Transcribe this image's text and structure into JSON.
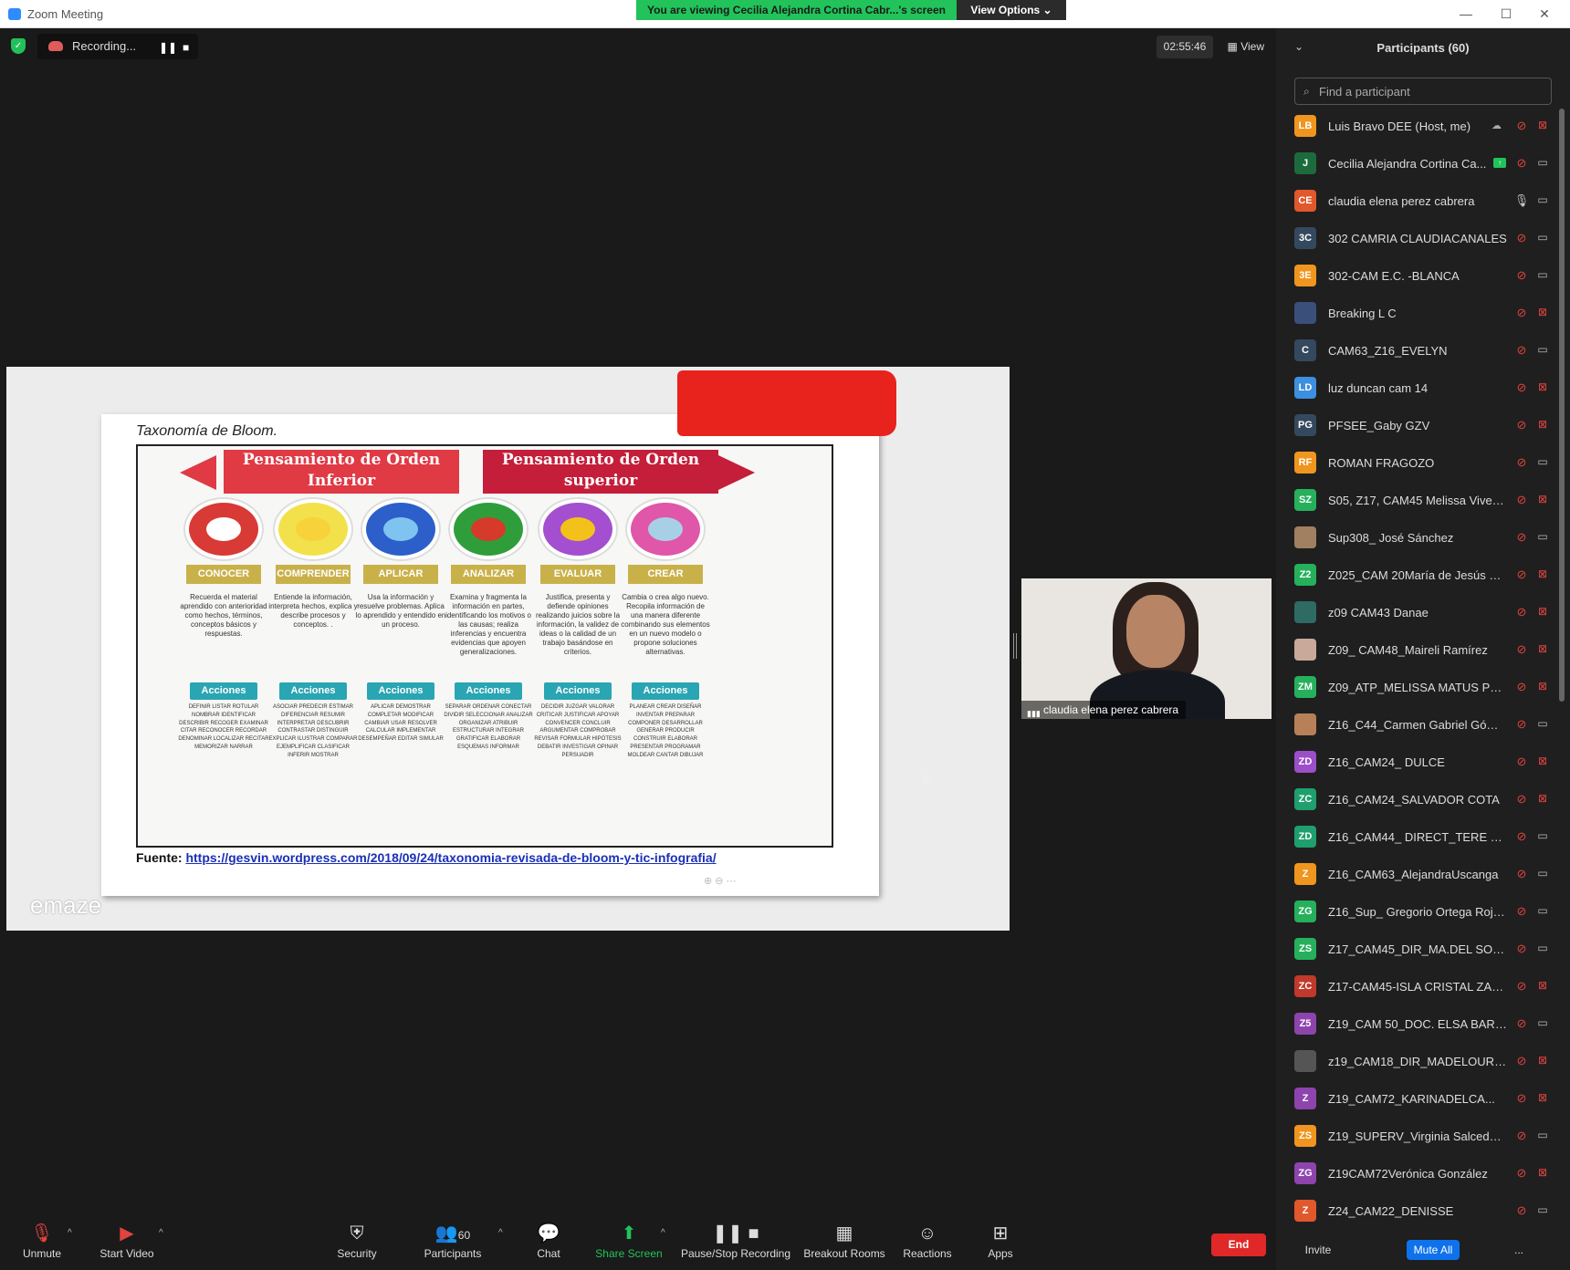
{
  "window": {
    "title": "Zoom Meeting",
    "controls": {
      "minimize": "—",
      "maximize": "☐",
      "close": "✕"
    }
  },
  "banner": {
    "viewing_text": "You are viewing Cecilia Alejandra Cortina Cabr...'s screen",
    "view_options": "View Options ⌄"
  },
  "recording": {
    "label": "Recording...",
    "pause": "❚❚",
    "stop": "■"
  },
  "meeting": {
    "timer": "02:55:46",
    "view_label": "View"
  },
  "shared_doc": {
    "title": "Taxonomía de Bloom.",
    "header_left": "Pensamiento de Orden Inferior",
    "header_right": "Pensamiento de Orden superior",
    "levels": [
      {
        "name": "CONOCER",
        "color": "#d83a35",
        "desc": "Recuerda el material aprendido con anterioridad como hechos, términos, conceptos básicos y respuestas.",
        "actions_label": "Acciones",
        "verbs": "DEFINIR LISTAR ROTULAR NOMBRAR IDENTIFICAR DESCRIBIR RECOGER EXAMINAR CITAR RECONOCER RECORDAR DENOMINAR LOCALIZAR RECITAR MEMORIZAR NARRAR"
      },
      {
        "name": "COMPRENDER",
        "color": "#f2e14a",
        "desc": "Entiende la información, interpreta hechos, explica y describe procesos y conceptos. .",
        "actions_label": "Acciones",
        "verbs": "ASOCIAR PREDECIR ESTIMAR DIFERENCIAR RESUMIR INTERPRETAR DESCUBRIR CONTRASTAR DISTINGUIR EXPLICAR ILUSTRAR COMPARAR EJEMPLIFICAR CLASIFICAR INFERIR MOSTRAR"
      },
      {
        "name": "APLICAR",
        "color": "#2c5fc9",
        "desc": "Usa la información y resuelve problemas. Aplica lo aprendido y entendido en un proceso.",
        "actions_label": "Acciones",
        "verbs": "APLICAR DEMOSTRAR COMPLETAR MODIFICAR CAMBIAR USAR RESOLVER CALCULAR IMPLEMENTAR DESEMPEÑAR EDITAR SIMULAR"
      },
      {
        "name": "ANALIZAR",
        "color": "#2f9e3a",
        "desc": "Examina y fragmenta la información en partes, identificando los motivos o las causas; realiza inferencias y encuentra evidencias que apoyen generalizaciones.",
        "actions_label": "Acciones",
        "verbs": "SEPARAR ORDENAR CONECTAR DIVIDIR SELECCIONAR ANALIZAR ORGANIZAR ATRIBUIR ESTRUCTURAR INTEGRAR GRATIFICAR ELABORAR ESQUEMAS INFORMAR"
      },
      {
        "name": "EVALUAR",
        "color": "#a34fd0",
        "desc": "Justifica, presenta y defiende opiniones realizando juicios sobre la información, la validez de ideas o la calidad de un trabajo basándose en criterios.",
        "actions_label": "Acciones",
        "verbs": "DECIDIR JUZGAR VALORAR CRITICAR JUSTIFICAR APOYAR CONVENCER CONCLUIR ARGUMENTAR COMPROBAR REVISAR FORMULAR HIPÓTESIS DEBATIR INVESTIGAR OPINAR PERSUADIR"
      },
      {
        "name": "CREAR",
        "color": "#e056a8",
        "desc": "Cambia o crea algo nuevo. Recopila información de una manera diferente combinando sus elementos en un nuevo modelo o propone soluciones alternativas.",
        "actions_label": "Acciones",
        "verbs": "PLANEAR CREAR DISEÑAR INVENTAR PREPARAR COMPONER DESARROLLAR GENERAR PRODUCIR CONSTRUIR ELABORAR PRESENTAR PROGRAMAR MOLDEAR CANTAR DIBUJAR"
      }
    ],
    "source_label": "Fuente:",
    "source_url": "https://gesvin.wordpress.com/2018/09/24/taxonomia-revisada-de-bloom-y-tic-infografia/",
    "zoom_tools": "⊕  ⊖  ⋯",
    "watermark": "emaze"
  },
  "camera": {
    "name": "claudia elena perez cabrera",
    "signal": "▮▮▮"
  },
  "toolbar": {
    "unmute": "Unmute",
    "start_video": "Start Video",
    "security": "Security",
    "participants": "Participants",
    "participants_count": "60",
    "chat": "Chat",
    "share_screen": "Share Screen",
    "pause_stop_recording": "Pause/Stop Recording",
    "breakout_rooms": "Breakout Rooms",
    "reactions": "Reactions",
    "apps": "Apps",
    "end": "End"
  },
  "panel": {
    "title": "Participants (60)",
    "search_placeholder": "Find a participant",
    "invite": "Invite",
    "mute_all": "Mute All",
    "more": "...",
    "participants": [
      {
        "initials": "LB",
        "name": "Luis Bravo DEE (Host, me)",
        "color": "#f0951e",
        "mic": "muted",
        "video": "off",
        "extra": "cloud"
      },
      {
        "initials": "J",
        "name": "Cecilia Alejandra Cortina Ca...",
        "color": "#1c6b3d",
        "mic": "muted",
        "video": "on",
        "extra": "share"
      },
      {
        "initials": "CE",
        "name": "claudia elena perez cabrera",
        "color": "#e0582c",
        "mic": "on",
        "video": "on",
        "extra": ""
      },
      {
        "initials": "3C",
        "name": "302  CAMRIA CLAUDIACANALES",
        "color": "#34495e",
        "mic": "muted",
        "video": "on",
        "extra": ""
      },
      {
        "initials": "3E",
        "name": "302-CAM E.C. -BLANCA",
        "color": "#f0951e",
        "mic": "muted",
        "video": "on",
        "extra": ""
      },
      {
        "initials": "",
        "name": "Breaking L C",
        "color": "#3a4f7a",
        "mic": "muted",
        "video": "off",
        "extra": ""
      },
      {
        "initials": "C",
        "name": "CAM63_Z16_EVELYN",
        "color": "#34495e",
        "mic": "muted",
        "video": "on",
        "extra": ""
      },
      {
        "initials": "LD",
        "name": "luz duncan cam 14",
        "color": "#3d8fe0",
        "mic": "muted",
        "video": "off",
        "extra": ""
      },
      {
        "initials": "PG",
        "name": "PFSEE_Gaby GZV",
        "color": "#34495e",
        "mic": "muted",
        "video": "off",
        "extra": ""
      },
      {
        "initials": "RF",
        "name": "ROMAN FRAGOZO",
        "color": "#f0951e",
        "mic": "muted",
        "video": "on",
        "extra": ""
      },
      {
        "initials": "SZ",
        "name": "S05, Z17, CAM45 Melissa Viveros",
        "color": "#26b05c",
        "mic": "muted",
        "video": "off",
        "extra": ""
      },
      {
        "initials": "",
        "name": "Sup308_ José Sánchez",
        "color": "#a08060",
        "mic": "muted",
        "video": "on",
        "extra": ""
      },
      {
        "initials": "Z2",
        "name": "Z025_CAM 20María de Jesús M...",
        "color": "#26b05c",
        "mic": "muted",
        "video": "off",
        "extra": ""
      },
      {
        "initials": "",
        "name": "z09 CAM43 Danae",
        "color": "#2e6b62",
        "mic": "muted",
        "video": "off",
        "extra": ""
      },
      {
        "initials": "",
        "name": "Z09_ CAM48_Maireli Ramírez",
        "color": "#c9a99a",
        "mic": "muted",
        "video": "off",
        "extra": ""
      },
      {
        "initials": "ZM",
        "name": "Z09_ATP_MELISSA MATUS PRIETO",
        "color": "#26b05c",
        "mic": "muted",
        "video": "off",
        "extra": ""
      },
      {
        "initials": "",
        "name": "Z16_C44_Carmen Gabriel Gómez",
        "color": "#b88058",
        "mic": "muted",
        "video": "on",
        "extra": ""
      },
      {
        "initials": "ZD",
        "name": "Z16_CAM24_ DULCE",
        "color": "#9b4fc9",
        "mic": "muted",
        "video": "off",
        "extra": ""
      },
      {
        "initials": "ZC",
        "name": "Z16_CAM24_SALVADOR COTA",
        "color": "#1f9e6e",
        "mic": "muted",
        "video": "off",
        "extra": ""
      },
      {
        "initials": "ZD",
        "name": "Z16_CAM44_ DIRECT_TERE VAS...",
        "color": "#1f9e6e",
        "mic": "muted",
        "video": "on",
        "extra": ""
      },
      {
        "initials": "Z",
        "name": "Z16_CAM63_AlejandraUscanga",
        "color": "#f0951e",
        "mic": "muted",
        "video": "on",
        "extra": ""
      },
      {
        "initials": "ZG",
        "name": "Z16_Sup_ Gregorio Ortega Roja...",
        "color": "#26b05c",
        "mic": "muted",
        "video": "on",
        "extra": ""
      },
      {
        "initials": "ZS",
        "name": "Z17_CAM45_DIR_MA.DEL SOCO...",
        "color": "#26b05c",
        "mic": "muted",
        "video": "on",
        "extra": ""
      },
      {
        "initials": "ZC",
        "name": "Z17-CAM45-ISLA CRISTAL ZAM...",
        "color": "#c0392b",
        "mic": "muted",
        "video": "off",
        "extra": ""
      },
      {
        "initials": "Z5",
        "name": "Z19_CAM 50_DOC. ELSA BARRA...",
        "color": "#8e44ad",
        "mic": "muted",
        "video": "on",
        "extra": ""
      },
      {
        "initials": "",
        "name": "z19_CAM18_DIR_MADELOURDE...",
        "color": "#555555",
        "mic": "muted",
        "video": "off",
        "extra": ""
      },
      {
        "initials": "Z",
        "name": "Z19_CAM72_KARINADELCA...",
        "color": "#8e44ad",
        "mic": "muted",
        "video": "off",
        "extra": ""
      },
      {
        "initials": "ZS",
        "name": "Z19_SUPERV_Virginia Salcedo Q...",
        "color": "#f0951e",
        "mic": "muted",
        "video": "on",
        "extra": ""
      },
      {
        "initials": "ZG",
        "name": "Z19CAM72Verónica González",
        "color": "#8e44ad",
        "mic": "muted",
        "video": "off",
        "extra": ""
      },
      {
        "initials": "Z",
        "name": "Z24_CAM22_DENISSE",
        "color": "#e0582c",
        "mic": "muted",
        "video": "on",
        "extra": ""
      }
    ]
  }
}
